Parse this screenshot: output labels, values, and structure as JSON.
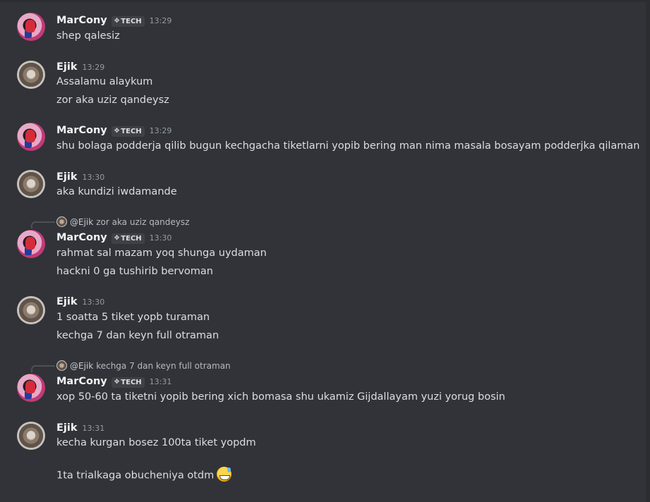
{
  "messages": [
    {
      "author": "MarCony",
      "tag": "TECH",
      "time": "13:29",
      "lines": [
        "shep qalesiz"
      ]
    },
    {
      "author": "Ejik",
      "time": "13:29",
      "lines": [
        "Assalamu alaykum",
        "zor aka uziz qandeysz"
      ]
    },
    {
      "author": "MarCony",
      "tag": "TECH",
      "time": "13:29",
      "lines": [
        "shu bolaga podderja qilib bugun kechgacha tiketlarni yopib bering man nima masala bosayam podderjka qilaman"
      ]
    },
    {
      "author": "Ejik",
      "time": "13:30",
      "lines": [
        "aka kundizi iwdamande"
      ]
    },
    {
      "reply": {
        "name": "@Ejik",
        "text": "zor aka uziz qandeysz"
      },
      "author": "MarCony",
      "tag": "TECH",
      "time": "13:30",
      "lines": [
        "rahmat sal mazam yoq shunga uydaman",
        "hackni 0 ga tushirib bervoman"
      ]
    },
    {
      "author": "Ejik",
      "time": "13:30",
      "lines": [
        "1 soatta 5 tiket yopb turaman",
        "kechga 7 dan keyn full otraman"
      ]
    },
    {
      "reply": {
        "name": "@Ejik",
        "text": "kechga 7 dan keyn full otraman"
      },
      "author": "MarCony",
      "tag": "TECH",
      "time": "13:31",
      "lines": [
        "xop 50-60 ta tiketni yopib bering xich bomasa shu ukamiz Gijdallayam yuzi yorug bosin"
      ]
    },
    {
      "author": "Ejik",
      "time": "13:31",
      "lines": [
        "kecha kurgan bosez 100ta tiket yopdm",
        "1ta trialkaga obucheniya otdm"
      ],
      "emoji": "sweat-smile-emoji"
    }
  ],
  "colors": {
    "background": "#313338",
    "text": "#dbdee1",
    "muted": "#949ba4",
    "name": "#f2f3f5",
    "tag_bg": "#3f4147"
  }
}
